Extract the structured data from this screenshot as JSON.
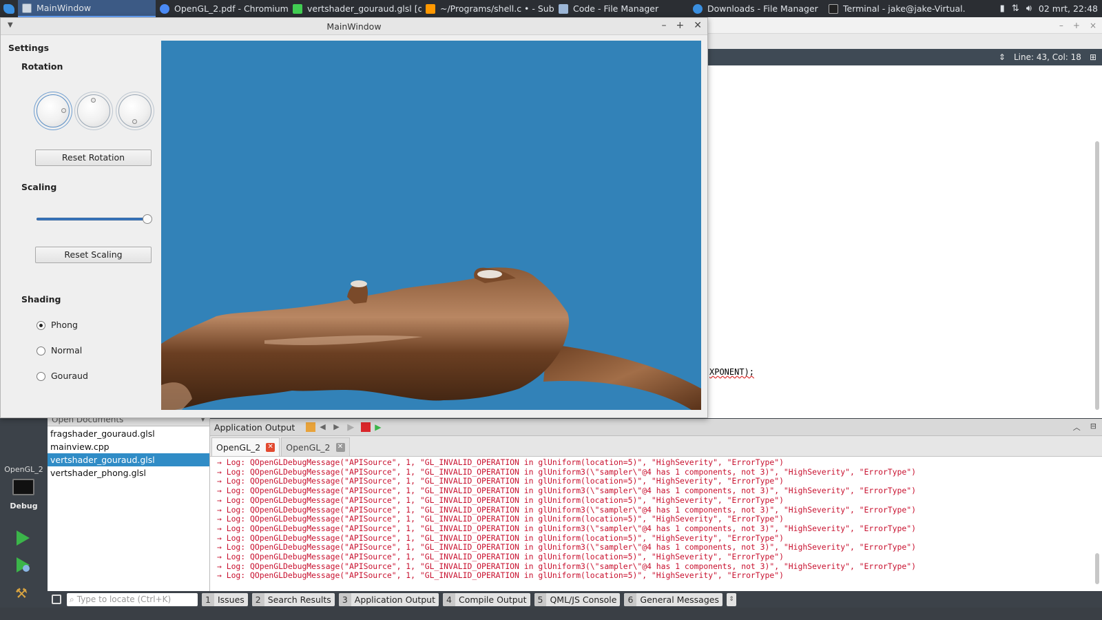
{
  "taskbar": {
    "tasks": [
      {
        "label": "MainWindow",
        "icon": "window-icon"
      },
      {
        "label": "OpenGL_2.pdf - Chromium",
        "icon": "chromium-icon"
      },
      {
        "label": "vertshader_gouraud.glsl [de...",
        "icon": "qtcreator-icon"
      },
      {
        "label": "~/Programs/shell.c • - Subli...",
        "icon": "sublime-icon"
      },
      {
        "label": "Code - File Manager",
        "icon": "folder-icon"
      },
      {
        "label": "Downloads - File Manager",
        "icon": "download-folder-icon"
      },
      {
        "label": "Terminal - jake@jake-Virtual...",
        "icon": "terminal-icon"
      }
    ],
    "clock": "02 mrt, 22:48"
  },
  "editor": {
    "cursor_position": "Line: 43, Col: 18",
    "code_fragment": "XPONENT);"
  },
  "mainwindow": {
    "title": "MainWindow",
    "settings_title": "Settings",
    "rotation_title": "Rotation",
    "reset_rotation": "Reset Rotation",
    "scaling_title": "Scaling",
    "scaling_value": 1.0,
    "reset_scaling": "Reset Scaling",
    "shading_title": "Shading",
    "shading_options": [
      "Phong",
      "Normal",
      "Gouraud"
    ],
    "shading_selected": "Phong"
  },
  "creator": {
    "open_documents": {
      "title": "Open Documents",
      "files": [
        "fragshader_gouraud.glsl",
        "mainview.cpp",
        "vertshader_gouraud.glsl",
        "vertshader_phong.glsl"
      ],
      "selected": "vertshader_gouraud.glsl"
    },
    "mode": {
      "project": "OpenGL_2",
      "build_config": "Debug"
    },
    "app_output": {
      "title": "Application Output",
      "tabs": [
        {
          "label": "OpenGL_2",
          "active": true
        },
        {
          "label": "OpenGL_2",
          "active": false
        }
      ],
      "log_lines": [
        "→ Log: QOpenGLDebugMessage(\"APISource\", 1, \"GL_INVALID_OPERATION in glUniform(location=5)\", \"HighSeverity\", \"ErrorType\")",
        "→ Log: QOpenGLDebugMessage(\"APISource\", 1, \"GL_INVALID_OPERATION in glUniform3(\\\"sampler\\\"@4 has 1 components, not 3)\", \"HighSeverity\", \"ErrorType\")",
        "→ Log: QOpenGLDebugMessage(\"APISource\", 1, \"GL_INVALID_OPERATION in glUniform(location=5)\", \"HighSeverity\", \"ErrorType\")",
        "→ Log: QOpenGLDebugMessage(\"APISource\", 1, \"GL_INVALID_OPERATION in glUniform3(\\\"sampler\\\"@4 has 1 components, not 3)\", \"HighSeverity\", \"ErrorType\")",
        "→ Log: QOpenGLDebugMessage(\"APISource\", 1, \"GL_INVALID_OPERATION in glUniform(location=5)\", \"HighSeverity\", \"ErrorType\")",
        "→ Log: QOpenGLDebugMessage(\"APISource\", 1, \"GL_INVALID_OPERATION in glUniform3(\\\"sampler\\\"@4 has 1 components, not 3)\", \"HighSeverity\", \"ErrorType\")",
        "→ Log: QOpenGLDebugMessage(\"APISource\", 1, \"GL_INVALID_OPERATION in glUniform(location=5)\", \"HighSeverity\", \"ErrorType\")",
        "→ Log: QOpenGLDebugMessage(\"APISource\", 1, \"GL_INVALID_OPERATION in glUniform3(\\\"sampler\\\"@4 has 1 components, not 3)\", \"HighSeverity\", \"ErrorType\")",
        "→ Log: QOpenGLDebugMessage(\"APISource\", 1, \"GL_INVALID_OPERATION in glUniform(location=5)\", \"HighSeverity\", \"ErrorType\")",
        "→ Log: QOpenGLDebugMessage(\"APISource\", 1, \"GL_INVALID_OPERATION in glUniform3(\\\"sampler\\\"@4 has 1 components, not 3)\", \"HighSeverity\", \"ErrorType\")",
        "→ Log: QOpenGLDebugMessage(\"APISource\", 1, \"GL_INVALID_OPERATION in glUniform(location=5)\", \"HighSeverity\", \"ErrorType\")",
        "→ Log: QOpenGLDebugMessage(\"APISource\", 1, \"GL_INVALID_OPERATION in glUniform3(\\\"sampler\\\"@4 has 1 components, not 3)\", \"HighSeverity\", \"ErrorType\")",
        "→ Log: QOpenGLDebugMessage(\"APISource\", 1, \"GL_INVALID_OPERATION in glUniform(location=5)\", \"HighSeverity\", \"ErrorType\")"
      ]
    },
    "statusbar": {
      "locate_placeholder": "Type to locate (Ctrl+K)",
      "panes": [
        {
          "num": "1",
          "label": "Issues"
        },
        {
          "num": "2",
          "label": "Search Results"
        },
        {
          "num": "3",
          "label": "Application Output"
        },
        {
          "num": "4",
          "label": "Compile Output"
        },
        {
          "num": "5",
          "label": "QML/JS Console"
        },
        {
          "num": "6",
          "label": "General Messages"
        }
      ]
    }
  },
  "colors": {
    "viewport_bg": "#3282b8",
    "log_text": "#c8102e",
    "selection": "#308cc6"
  }
}
